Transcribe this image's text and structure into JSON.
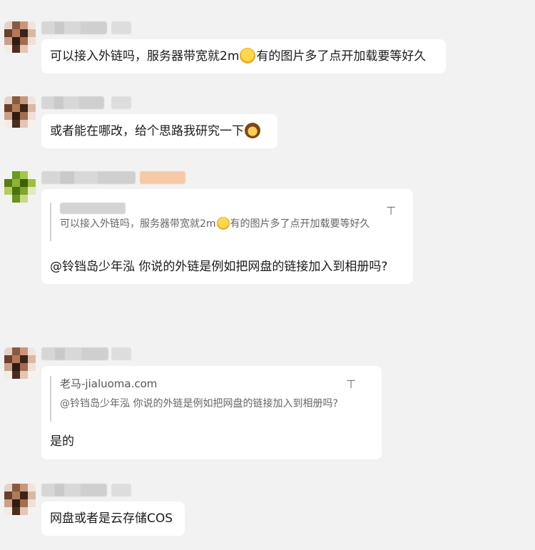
{
  "messages": [
    {
      "text": "可以接入外链吗，服务器带宽就2m",
      "emoji": "face-tongue-emoji",
      "text_after": "有的图片多了点开加载要等好久"
    },
    {
      "text": "或者能在哪改，给个思路我研究一下",
      "emoji": "bear-emoji"
    },
    {
      "quote_text": "可以接入外链吗，服务器带宽就2m",
      "quote_text_after": "有的图片多了点开加载要等好久",
      "text": "@铃铛岛少年泓 你说的外链是例如把网盘的链接加入到相册吗?"
    },
    {
      "quote_name": "老马-jialuoma.com",
      "quote_text": "@铃铛岛少年泓 你说的外链是例如把网盘的链接加入到相册吗?",
      "text": "是的"
    },
    {
      "text": "网盘或者是云存储COS"
    }
  ],
  "icons": {
    "pin": "pin-icon",
    "pin_glyph": "⊤"
  },
  "colors": {
    "background": "#f2f2f2",
    "bubble": "#ffffff",
    "quote_bar": "#d0d0d0",
    "highlight_tag": "#f6c9a8"
  }
}
